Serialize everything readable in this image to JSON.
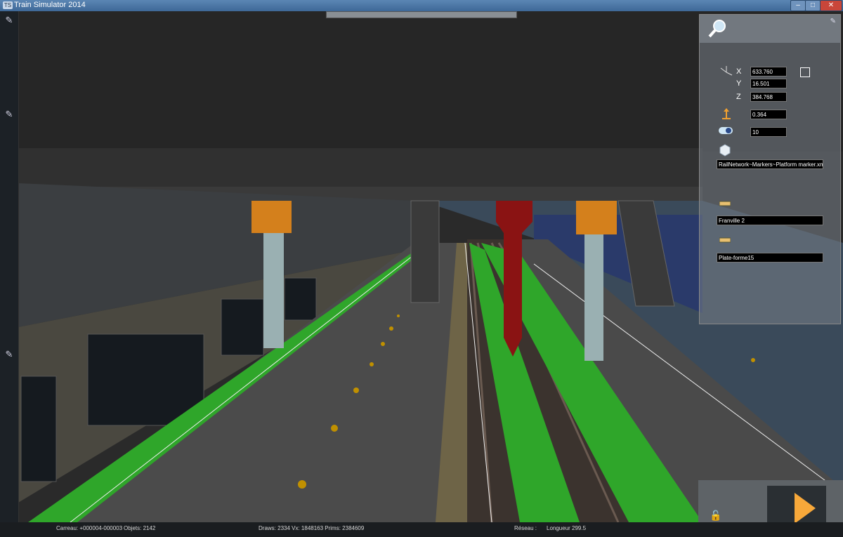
{
  "window": {
    "title": "Train Simulator 2014",
    "icon": "TS",
    "controls": {
      "minimize": "–",
      "maximize": "□",
      "close": "✕"
    }
  },
  "panel": {
    "x_label": "X",
    "y_label": "Y",
    "z_label": "Z",
    "x_value": "633.760",
    "y_value": "16.501",
    "z_value": "384.768",
    "height_value": "0.364",
    "count_value": "10",
    "object_value": "RailNetwork~Markers~Platform marker.xml",
    "station_value": "Franville 2",
    "platform_value": "Plate-forme15",
    "colors": {
      "field_bg": "#000000",
      "accent": "#f0a030"
    }
  },
  "statusbar": {
    "tile": "Carreau: +000004-000003",
    "objects": "Objets: 2142",
    "draws": "Draws: 2334 Vx: 1848163 Prims: 2384609",
    "network": "Réseau :",
    "length": "Longueur  299.5"
  },
  "icons": {
    "magnifier": "magnifier-icon",
    "axes": "axes-icon",
    "height": "height-icon",
    "toggle": "toggle-icon",
    "cube": "cube-icon",
    "platform": "platform-icon",
    "lock": "unlock-icon",
    "play": "play-icon"
  }
}
